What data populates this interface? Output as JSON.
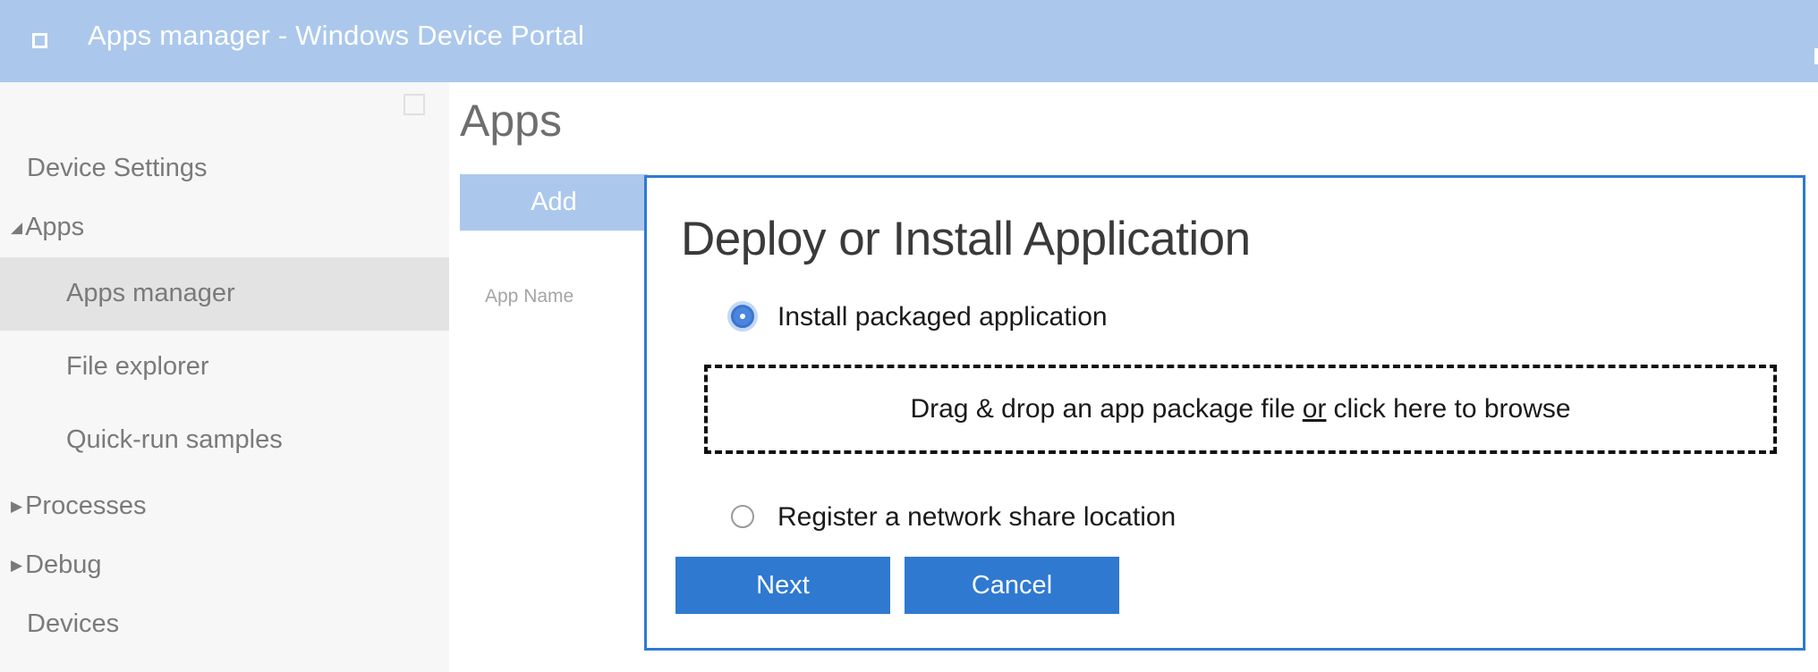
{
  "window": {
    "title": "Apps manager - Windows Device Portal",
    "app_icon": "app-window-icon"
  },
  "sidebar": {
    "collapse_icon": "collapse-toggle-icon",
    "items": [
      {
        "label": "Device Settings",
        "expanded": null,
        "selected": false
      },
      {
        "label": "Apps",
        "expanded": true,
        "arrow": "◢",
        "selected": false
      },
      {
        "label": "Apps manager",
        "selected": true
      },
      {
        "label": "File explorer",
        "selected": false
      },
      {
        "label": "Quick-run samples",
        "selected": false
      },
      {
        "label": "Processes",
        "expanded": false,
        "arrow": "▶",
        "selected": false
      },
      {
        "label": "Debug",
        "expanded": false,
        "arrow": "▶",
        "selected": false
      },
      {
        "label": "Devices",
        "selected": false
      }
    ]
  },
  "main": {
    "heading": "Apps",
    "add_button": "Add",
    "table_header": "App Name"
  },
  "dialog": {
    "title": "Deploy or Install Application",
    "options": [
      {
        "label": "Install packaged application",
        "checked": true
      },
      {
        "label": "Register a network share location",
        "checked": false
      }
    ],
    "dropzone": {
      "text_before": "Drag & drop an app package file",
      "or_link": "or",
      "text_after": "click here to browse"
    },
    "next_button": "Next",
    "cancel_button": "Cancel"
  },
  "colors": {
    "title_bar": "#abc8ec",
    "accent": "#2f79d1",
    "sidebar_bg": "#f7f7f7",
    "sidebar_selected": "#e3e3e3"
  }
}
